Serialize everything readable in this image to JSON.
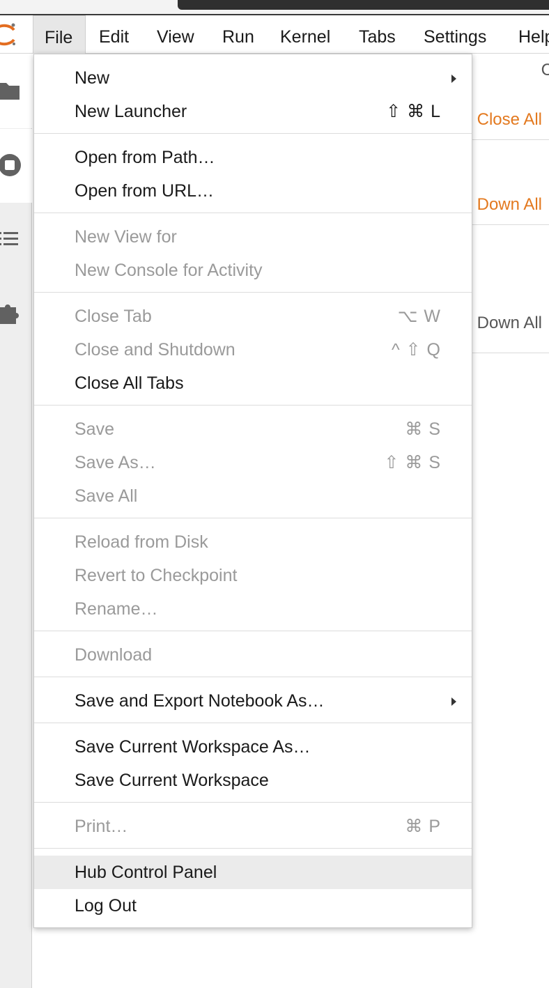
{
  "menubar": {
    "items": [
      {
        "label": "File"
      },
      {
        "label": "Edit"
      },
      {
        "label": "View"
      },
      {
        "label": "Run"
      },
      {
        "label": "Kernel"
      },
      {
        "label": "Tabs"
      },
      {
        "label": "Settings"
      },
      {
        "label": "Help"
      }
    ],
    "active": "File"
  },
  "sidebar": {
    "icons": [
      "folder-icon",
      "running-stop-icon",
      "table-of-contents-icon",
      "extension-puzzle-icon"
    ]
  },
  "background_panel": {
    "close_all": "Close All",
    "shut_down_all_1": "Shut Down All",
    "shut_down_all_2": "Shut Down All"
  },
  "file_menu": {
    "new": {
      "label": "New"
    },
    "new_launcher": {
      "label": "New Launcher",
      "shortcut": "⇧ ⌘ L"
    },
    "open_from_path": {
      "label": "Open from Path…"
    },
    "open_from_url": {
      "label": "Open from URL…"
    },
    "new_view_for": {
      "label": "New View for"
    },
    "new_console_for_activity": {
      "label": "New Console for Activity"
    },
    "close_tab": {
      "label": "Close Tab",
      "shortcut": "⌥ W"
    },
    "close_and_shutdown": {
      "label": "Close and Shutdown",
      "shortcut": "^ ⇧ Q"
    },
    "close_all_tabs": {
      "label": "Close All Tabs"
    },
    "save": {
      "label": "Save",
      "shortcut": "⌘ S"
    },
    "save_as": {
      "label": "Save As…",
      "shortcut": "⇧ ⌘ S"
    },
    "save_all": {
      "label": "Save All"
    },
    "reload_from_disk": {
      "label": "Reload from Disk"
    },
    "revert_to_checkpoint": {
      "label": "Revert to Checkpoint"
    },
    "rename": {
      "label": "Rename…"
    },
    "download": {
      "label": "Download"
    },
    "save_and_export": {
      "label": "Save and Export Notebook As…"
    },
    "save_workspace_as": {
      "label": "Save Current Workspace As…"
    },
    "save_workspace": {
      "label": "Save Current Workspace"
    },
    "print": {
      "label": "Print…",
      "shortcut": "⌘ P"
    },
    "hub_control_panel": {
      "label": "Hub Control Panel"
    },
    "log_out": {
      "label": "Log Out"
    }
  },
  "colors": {
    "accent_orange": "#e3791f",
    "disabled_text": "#9a9a9a",
    "hover_bg": "#ebebeb"
  }
}
